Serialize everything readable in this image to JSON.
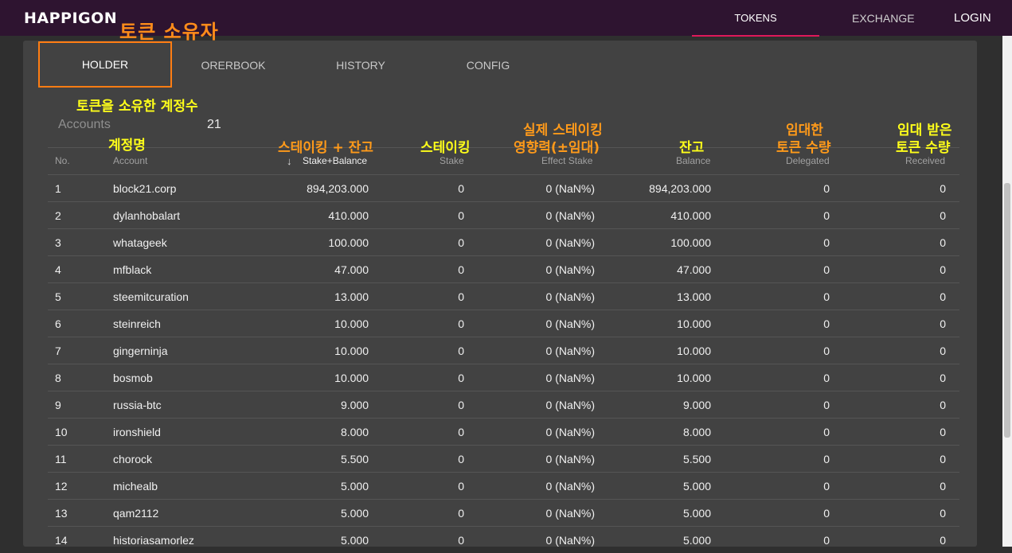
{
  "brand": "HAPPIGON",
  "nav": {
    "tokens": "TOKENS",
    "exchange": "EXCHANGE",
    "login": "LOGIN"
  },
  "page_title_annotation": "토큰 소유자",
  "tabs": {
    "holder": "HOLDER",
    "orderbook": "ORERBOOK",
    "history": "HISTORY",
    "config": "CONFIG"
  },
  "annotations": {
    "accounts_count": "토큰을 소유한 계정수",
    "account_name": "계정명",
    "stake_balance": "스테이킹 + 잔고",
    "stake": "스테이킹",
    "effect_stake_1": "실제 스테이킹",
    "effect_stake_2": "영향력(±임대)",
    "balance": "잔고",
    "delegated_1": "임대한",
    "delegated_2": "토큰 수량",
    "received_1": "임대 받은",
    "received_2": "토큰 수량"
  },
  "summary": {
    "label": "Accounts",
    "value": "21"
  },
  "table": {
    "headers": {
      "no": "No.",
      "account": "Account",
      "stake_balance": "Stake+Balance",
      "stake": "Stake",
      "effect_stake": "Effect Stake",
      "balance": "Balance",
      "delegated": "Delegated",
      "received": "Received"
    },
    "rows": [
      {
        "no": "1",
        "account": "block21.corp",
        "stake_balance": "894,203.000",
        "stake": "0",
        "effect_stake": "0 (NaN%)",
        "balance": "894,203.000",
        "delegated": "0",
        "received": "0"
      },
      {
        "no": "2",
        "account": "dylanhobalart",
        "stake_balance": "410.000",
        "stake": "0",
        "effect_stake": "0 (NaN%)",
        "balance": "410.000",
        "delegated": "0",
        "received": "0"
      },
      {
        "no": "3",
        "account": "whatageek",
        "stake_balance": "100.000",
        "stake": "0",
        "effect_stake": "0 (NaN%)",
        "balance": "100.000",
        "delegated": "0",
        "received": "0"
      },
      {
        "no": "4",
        "account": "mfblack",
        "stake_balance": "47.000",
        "stake": "0",
        "effect_stake": "0 (NaN%)",
        "balance": "47.000",
        "delegated": "0",
        "received": "0"
      },
      {
        "no": "5",
        "account": "steemitcuration",
        "stake_balance": "13.000",
        "stake": "0",
        "effect_stake": "0 (NaN%)",
        "balance": "13.000",
        "delegated": "0",
        "received": "0"
      },
      {
        "no": "6",
        "account": "steinreich",
        "stake_balance": "10.000",
        "stake": "0",
        "effect_stake": "0 (NaN%)",
        "balance": "10.000",
        "delegated": "0",
        "received": "0"
      },
      {
        "no": "7",
        "account": "gingerninja",
        "stake_balance": "10.000",
        "stake": "0",
        "effect_stake": "0 (NaN%)",
        "balance": "10.000",
        "delegated": "0",
        "received": "0"
      },
      {
        "no": "8",
        "account": "bosmob",
        "stake_balance": "10.000",
        "stake": "0",
        "effect_stake": "0 (NaN%)",
        "balance": "10.000",
        "delegated": "0",
        "received": "0"
      },
      {
        "no": "9",
        "account": "russia-btc",
        "stake_balance": "9.000",
        "stake": "0",
        "effect_stake": "0 (NaN%)",
        "balance": "9.000",
        "delegated": "0",
        "received": "0"
      },
      {
        "no": "10",
        "account": "ironshield",
        "stake_balance": "8.000",
        "stake": "0",
        "effect_stake": "0 (NaN%)",
        "balance": "8.000",
        "delegated": "0",
        "received": "0"
      },
      {
        "no": "11",
        "account": "chorock",
        "stake_balance": "5.500",
        "stake": "0",
        "effect_stake": "0 (NaN%)",
        "balance": "5.500",
        "delegated": "0",
        "received": "0"
      },
      {
        "no": "12",
        "account": "michealb",
        "stake_balance": "5.000",
        "stake": "0",
        "effect_stake": "0 (NaN%)",
        "balance": "5.000",
        "delegated": "0",
        "received": "0"
      },
      {
        "no": "13",
        "account": "qam2112",
        "stake_balance": "5.000",
        "stake": "0",
        "effect_stake": "0 (NaN%)",
        "balance": "5.000",
        "delegated": "0",
        "received": "0"
      },
      {
        "no": "14",
        "account": "historiasamorlez",
        "stake_balance": "5.000",
        "stake": "0",
        "effect_stake": "0 (NaN%)",
        "balance": "5.000",
        "delegated": "0",
        "received": "0"
      }
    ]
  }
}
